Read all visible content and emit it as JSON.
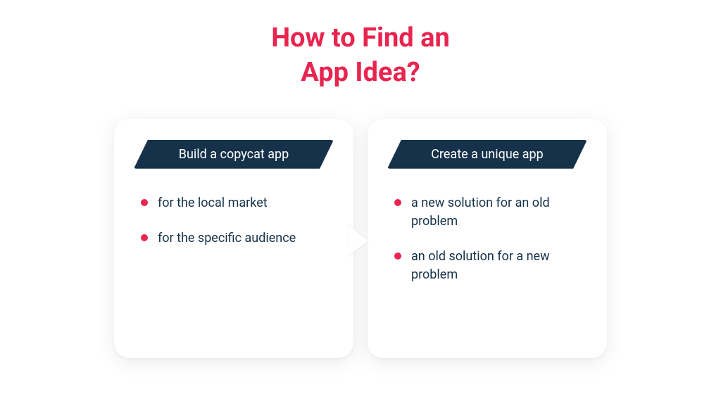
{
  "title_line1": "How to Find an",
  "title_line2": "App Idea?",
  "colors": {
    "accent": "#e8244f",
    "dark": "#16324a"
  },
  "cards": [
    {
      "header": "Build a copycat app",
      "bullets": [
        "for the local market",
        "for the specific audience"
      ]
    },
    {
      "header": "Create a unique app",
      "bullets": [
        "a new solution for an old problem",
        "an old solution for a new problem"
      ]
    }
  ]
}
